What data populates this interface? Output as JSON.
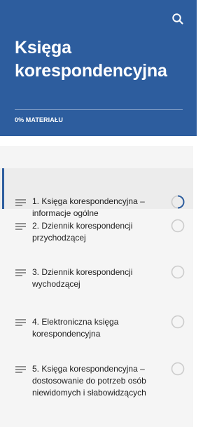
{
  "header": {
    "title": "Księga korespondencyjna",
    "progress_label": "0% MATERIAŁU",
    "progress_percent": 0,
    "background_color": "#2d5d9e",
    "search_icon": "search-icon"
  },
  "lessons": [
    {
      "label": "1. Księga korespondencyjna – informacje ogólne",
      "status": "in-progress",
      "active": true
    },
    {
      "label": "2. Dziennik korespondencji przychodzącej",
      "status": "not-started",
      "active": false
    },
    {
      "label": "3. Dziennik korespondencji wychodzącej",
      "status": "not-started",
      "active": false
    },
    {
      "label": "4. Elektroniczna księga korespondencyjna",
      "status": "not-started",
      "active": false
    },
    {
      "label": "5. Księga korespondencyjna – dostosowanie do potrzeb osób niewidomych i słabowidzących",
      "status": "not-started",
      "active": false
    }
  ],
  "icons": {
    "lesson_icon": "text-lines-icon",
    "status_in_progress": "progress-circle-icon",
    "status_not_started": "empty-circle-icon"
  },
  "colors": {
    "accent": "#2d5d9e",
    "active_row": "#ececec",
    "list_background": "#f5f5f5",
    "status_circle": "#cccccc"
  }
}
